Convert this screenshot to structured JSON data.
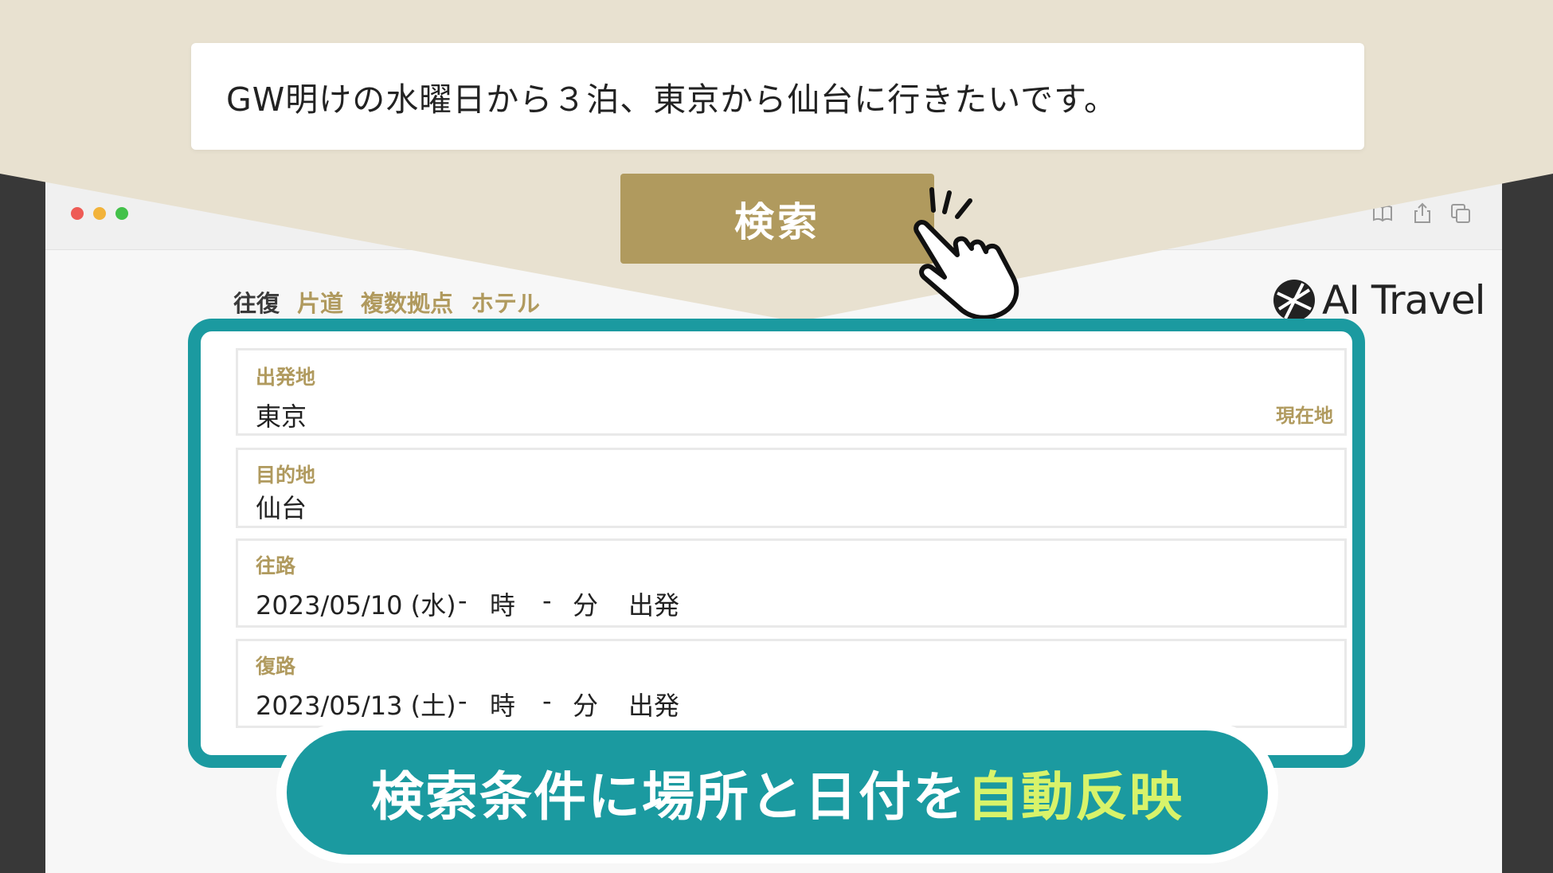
{
  "prompt": {
    "text": "GW明けの水曜日から３泊、東京から仙台に行きたいです。"
  },
  "search_button": {
    "label": "検索"
  },
  "tabs": [
    {
      "label": "往復",
      "active": true
    },
    {
      "label": "片道",
      "active": false
    },
    {
      "label": "複数拠点",
      "active": false
    },
    {
      "label": "ホテル",
      "active": false
    }
  ],
  "logo": {
    "text": "AI Travel"
  },
  "form": {
    "departure": {
      "label": "出発地",
      "value": "東京",
      "current_location": "現在地"
    },
    "destination": {
      "label": "目的地",
      "value": "仙台"
    },
    "outbound": {
      "label": "往路",
      "date": "2023/05/10 (水)",
      "hour": "-",
      "hour_unit": "時",
      "minute": "-",
      "minute_unit": "分",
      "mode": "出発"
    },
    "return": {
      "label": "復路",
      "date": "2023/05/13 (土)",
      "hour": "-",
      "hour_unit": "時",
      "minute": "-",
      "minute_unit": "分",
      "mode": "出発"
    }
  },
  "caption": {
    "main": "検索条件に場所と日付を",
    "highlight": "自動反映"
  },
  "colors": {
    "beige_bg": "#e8e1d0",
    "gold": "#b09a5e",
    "teal": "#1b9aa0",
    "highlight": "#d8f36a",
    "dark_bg": "#383838"
  },
  "icons": [
    "reader-icon",
    "share-icon",
    "tabs-icon",
    "pointing-hand-icon",
    "ai-travel-logo-icon"
  ]
}
